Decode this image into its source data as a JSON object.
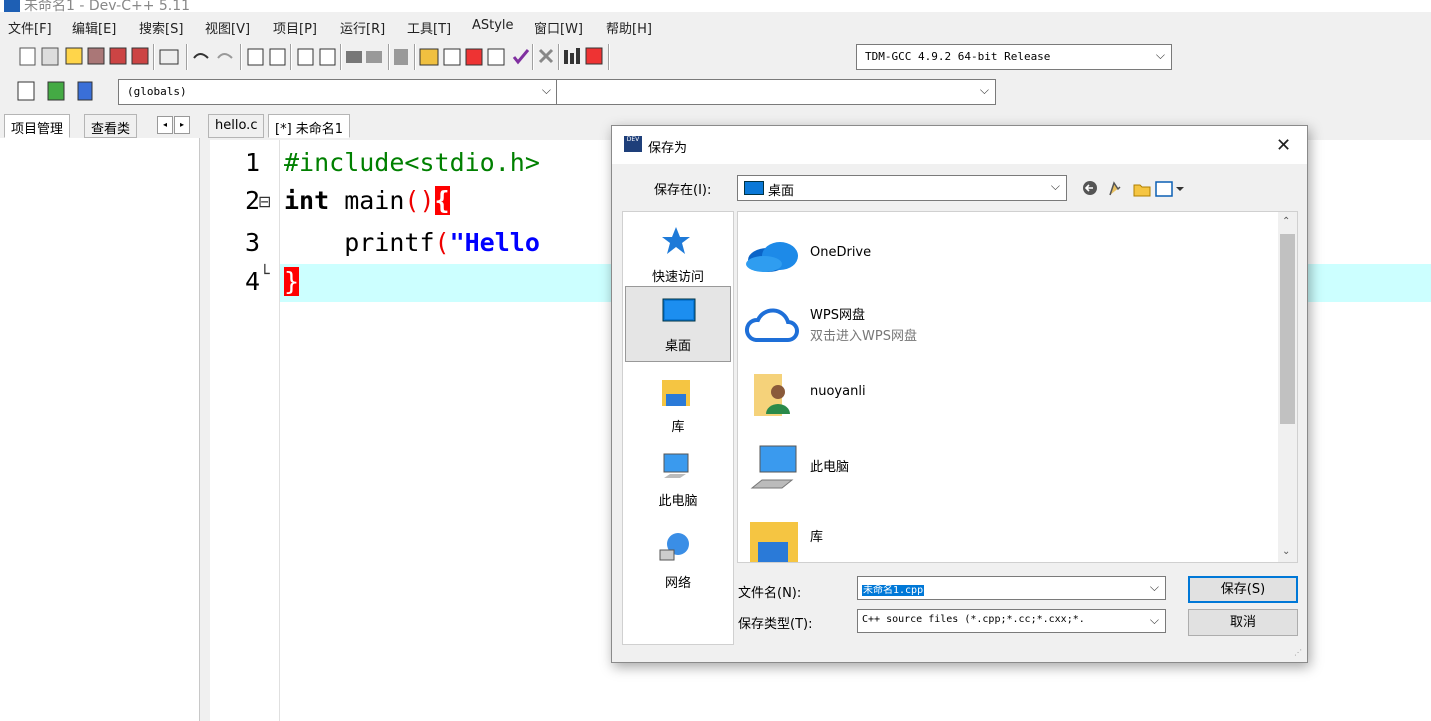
{
  "window": {
    "title": "未命名1 - Dev-C++ 5.11"
  },
  "menu": [
    "文件[F]",
    "编辑[E]",
    "搜索[S]",
    "视图[V]",
    "项目[P]",
    "运行[R]",
    "工具[T]",
    "AStyle",
    "窗口[W]",
    "帮助[H]"
  ],
  "toolbar": {
    "compiler": "TDM-GCC 4.9.2 64-bit Release",
    "scope": "(globals)",
    "function": ""
  },
  "left_panel": {
    "tabs": [
      "项目管理",
      "查看类"
    ],
    "nav_prev": "◂",
    "nav_next": "▸"
  },
  "editor": {
    "tabs": [
      "hello.c",
      "[*] 未命名1"
    ],
    "lines": [
      {
        "num": "1",
        "text": "#include<stdio.h>"
      },
      {
        "num": "2",
        "text": "int main(){"
      },
      {
        "num": "3",
        "text": "    printf(\"Hello"
      },
      {
        "num": "4",
        "text": "}"
      }
    ],
    "fold_open": "⊟",
    "fold_end": "└",
    "brace_open": "{",
    "brace_close": "}"
  },
  "dialog": {
    "title": "保存为",
    "close": "✕",
    "save_in_label": "保存在(I):",
    "save_in_value": "桌面",
    "places": [
      "快速访问",
      "桌面",
      "库",
      "此电脑",
      "网络"
    ],
    "selected_place": "桌面",
    "files": [
      {
        "name": "OneDrive",
        "sub": ""
      },
      {
        "name": "WPS网盘",
        "sub": "双击进入WPS网盘"
      },
      {
        "name": "nuoyanli",
        "sub": ""
      },
      {
        "name": "此电脑",
        "sub": ""
      },
      {
        "name": "库",
        "sub": ""
      }
    ],
    "filename_label": "文件名(N):",
    "filename_value": "未命名1.cpp",
    "filetype_label": "保存类型(T):",
    "filetype_value": "C++ source files (*.cpp;*.cc;*.cxx;*.",
    "save_button": "保存(S)",
    "cancel_button": "取消"
  },
  "colors": {
    "accent": "#0078d7",
    "highlight_line": "#ccffff",
    "keyword_green": "#008000",
    "string_blue": "#0000ff",
    "brace_red": "#ff0000"
  }
}
